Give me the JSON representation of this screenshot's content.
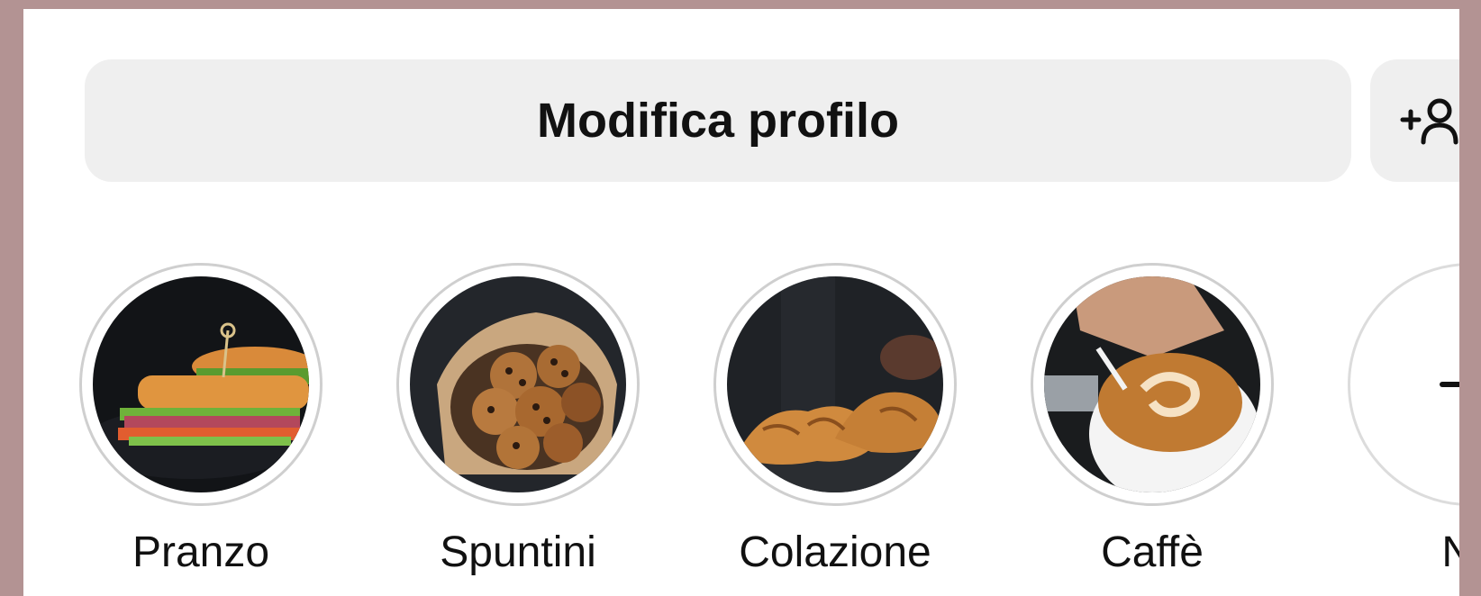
{
  "profile_actions": {
    "edit_label": "Modifica profilo",
    "add_person_icon": "add-person-icon"
  },
  "highlights": [
    {
      "label": "Pranzo",
      "image": "sandwich photo"
    },
    {
      "label": "Spuntini",
      "image": "cookies photo"
    },
    {
      "label": "Colazione",
      "image": "croissants photo"
    },
    {
      "label": "Caffè",
      "image": "latte art photo"
    },
    {
      "label": "Nu",
      "icon": "plus-icon"
    }
  ],
  "colors": {
    "background_frame": "#b39393",
    "button_bg": "#efefef",
    "ring_border": "#cfcfcf",
    "text": "#111111"
  }
}
